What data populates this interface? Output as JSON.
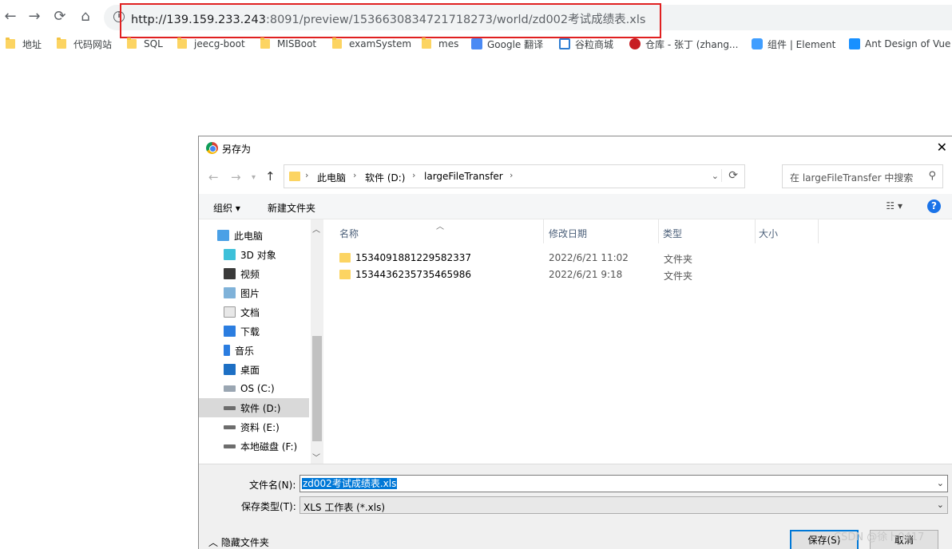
{
  "browser": {
    "url_host": "http://139.159.233.243",
    "url_rest": ":8091/preview/1536630834721718273/world/zd002考试成绩表.xls"
  },
  "bookmarks": [
    {
      "label": "地址",
      "icon": "folder-icon"
    },
    {
      "label": "代码网站",
      "icon": "folder-icon"
    },
    {
      "label": "SQL",
      "icon": "folder-icon"
    },
    {
      "label": "jeecg-boot",
      "icon": "folder-icon"
    },
    {
      "label": "MISBoot",
      "icon": "folder-icon"
    },
    {
      "label": "examSystem",
      "icon": "folder-icon"
    },
    {
      "label": "mes",
      "icon": "folder-icon"
    },
    {
      "label": "Google 翻译",
      "icon": "google-translate-icon"
    },
    {
      "label": "谷粒商城",
      "icon": "gulimall-icon"
    },
    {
      "label": "仓库 - 张丁 (zhang...",
      "icon": "gitee-icon"
    },
    {
      "label": "组件 | Element",
      "icon": "element-icon"
    },
    {
      "label": "Ant Design of Vue",
      "icon": "antd-icon"
    }
  ],
  "dialog": {
    "title": "另存为",
    "breadcrumb": [
      "此电脑",
      "软件 (D:)",
      "largeFileTransfer"
    ],
    "search_placeholder": "在 largeFileTransfer 中搜索",
    "commands": {
      "organize": "组织 ▾",
      "new_folder": "新建文件夹"
    },
    "nav_items": [
      {
        "label": "此电脑",
        "icon": "computer-icon"
      },
      {
        "label": "3D 对象",
        "icon": "3d-objects-icon"
      },
      {
        "label": "视频",
        "icon": "video-icon"
      },
      {
        "label": "图片",
        "icon": "pictures-icon"
      },
      {
        "label": "文档",
        "icon": "documents-icon"
      },
      {
        "label": "下载",
        "icon": "download-icon"
      },
      {
        "label": "音乐",
        "icon": "music-icon"
      },
      {
        "label": "桌面",
        "icon": "desktop-icon"
      },
      {
        "label": "OS (C:)",
        "icon": "drive-icon"
      },
      {
        "label": "软件 (D:)",
        "icon": "drive-icon",
        "selected": true
      },
      {
        "label": "资料 (E:)",
        "icon": "drive-icon"
      },
      {
        "label": "本地磁盘 (F:)",
        "icon": "drive-icon"
      }
    ],
    "columns": [
      "名称",
      "修改日期",
      "类型",
      "大小"
    ],
    "files": [
      {
        "name": "1534091881229582337",
        "date": "2022/6/21 11:02",
        "type": "文件夹"
      },
      {
        "name": "1534436235735465986",
        "date": "2022/6/21 9:18",
        "type": "文件夹"
      }
    ],
    "filename_label": "文件名(N):",
    "filename_value": "zd002考试成绩表.xls",
    "filetype_label": "保存类型(T):",
    "filetype_value": "XLS 工作表 (*.xls)",
    "hide_folders": "隐藏文件夹",
    "save_label": "保存(S)",
    "cancel_label": "取消"
  },
  "watermark": "CSDN @徐卜0417"
}
